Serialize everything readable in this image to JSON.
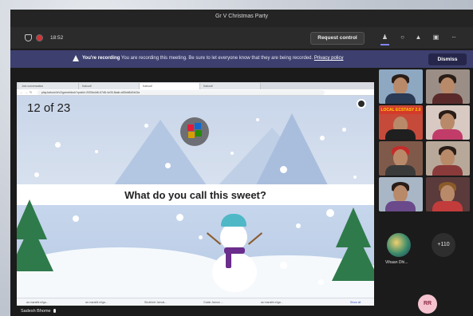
{
  "window": {
    "title": "Gr V Christmas Party"
  },
  "toolbar": {
    "time": "18:52",
    "request_control_label": "Request control",
    "more_label": "···"
  },
  "banner": {
    "strong": "You're recording",
    "text": " You are recording this meeting. Be sure to let everyone know that they are being recorded.",
    "link": "Privacy policy",
    "dismiss_label": "Dismiss"
  },
  "shared_screen": {
    "browser_tabs": [
      "Join conversation",
      "Kahoot!",
      "Kahoot!",
      "Kahoot!"
    ],
    "url": "play.kahoot.it/v2/gameblock?quizId=2005a4d6-67d8-4c05-8aab-a53dd6d2d43a",
    "counter": "12 of 23",
    "question": "What do you call this sweet?",
    "answers": [
      "as marathi nilga...",
      "as marathi nilga...",
      "Strothkirt Jamuk...",
      "Gulab Jamun ...",
      "as marathi nilga..."
    ],
    "show_all": "Show all"
  },
  "presenter": {
    "name": "Sadesh Bhome"
  },
  "gallery": {
    "tile_banner": "LOCAL ECSTASY 2.0",
    "vihaan_name": "Vihaan Dhi...",
    "more_count": "+110",
    "me_initials": "RR"
  },
  "colors": {
    "teams_purple": "#3d3f6e",
    "record_red": "#d13438",
    "tree_green": "#2f7a4b",
    "snowman_hat": "#4fb8c7"
  }
}
